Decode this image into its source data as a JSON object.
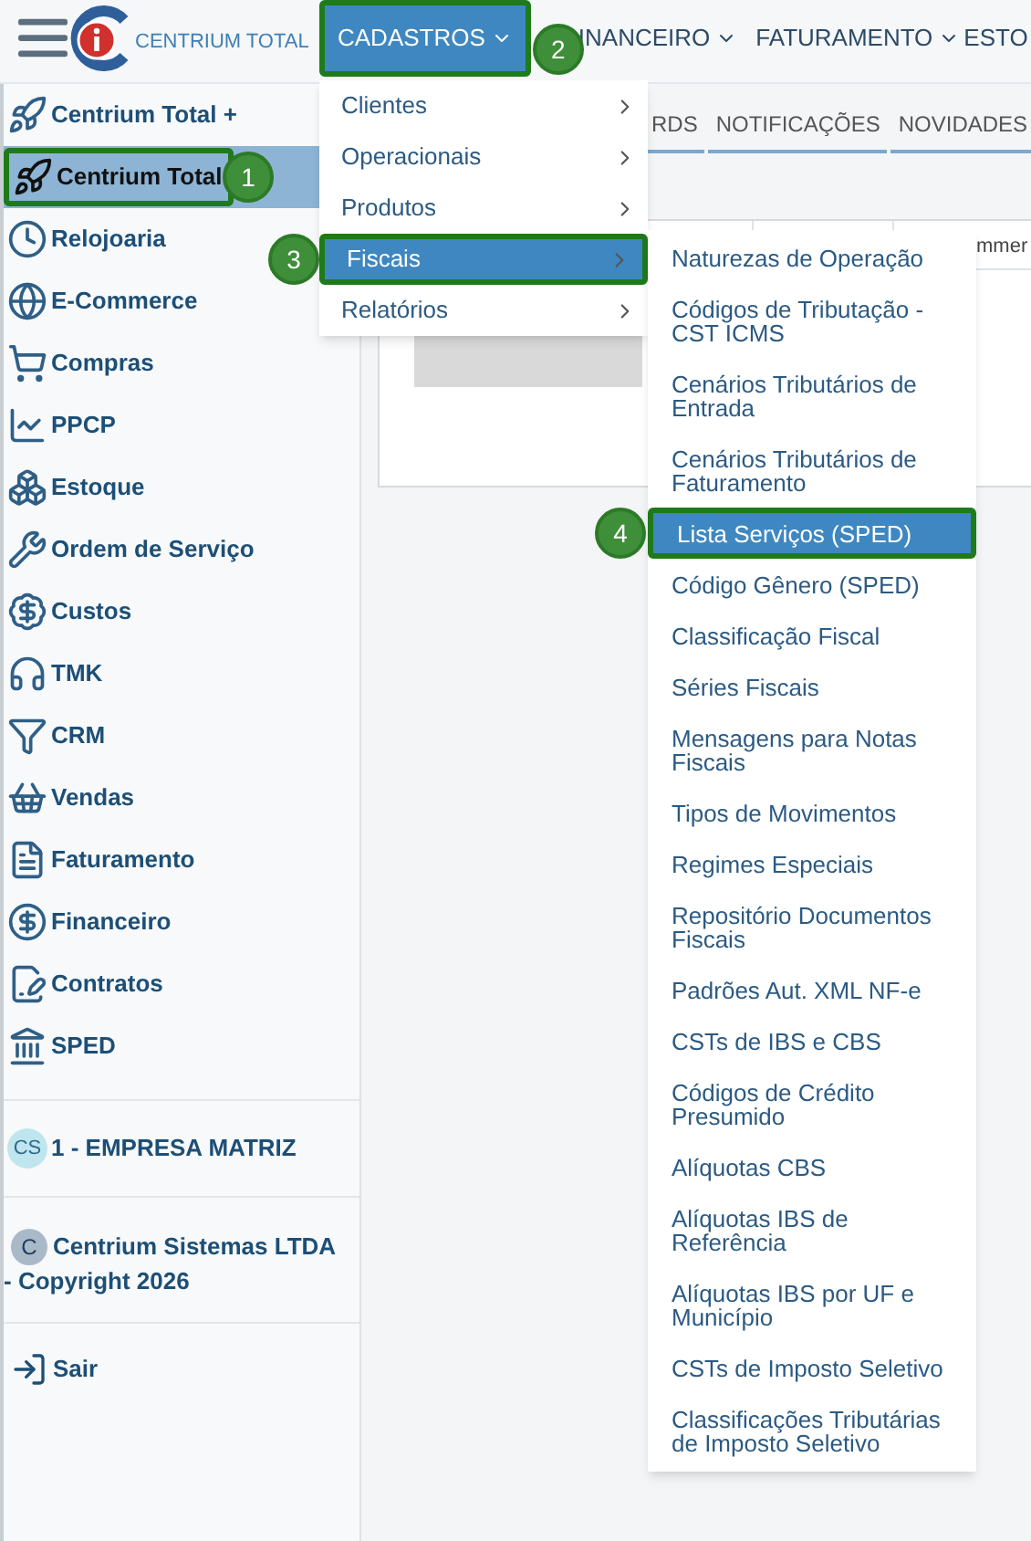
{
  "app": {
    "title": "CENTRIUM TOTAL"
  },
  "nav": [
    {
      "label": "CADASTROS",
      "selected": true,
      "callout": "2"
    },
    {
      "label": "INANCEIRO",
      "selected": false
    },
    {
      "label": "FATURAMENTO",
      "selected": false
    },
    {
      "label": "ESTO",
      "selected": false
    }
  ],
  "sidebar": {
    "items": [
      {
        "label": "Centrium Total +",
        "selected": false
      },
      {
        "label": "Centrium Total",
        "selected": true,
        "callout": "1"
      },
      {
        "label": "Relojoaria",
        "selected": false
      },
      {
        "label": "E-Commerce",
        "selected": false
      },
      {
        "label": "Compras",
        "selected": false
      },
      {
        "label": "PPCP",
        "selected": false
      },
      {
        "label": "Estoque",
        "selected": false
      },
      {
        "label": "Ordem de Serviço",
        "selected": false
      },
      {
        "label": "Custos",
        "selected": false
      },
      {
        "label": "TMK",
        "selected": false
      },
      {
        "label": "CRM",
        "selected": false
      },
      {
        "label": "Vendas",
        "selected": false
      },
      {
        "label": "Faturamento",
        "selected": false
      },
      {
        "label": "Financeiro",
        "selected": false
      },
      {
        "label": "Contratos",
        "selected": false
      },
      {
        "label": "SPED",
        "selected": false
      }
    ],
    "company": {
      "avatar": "CS",
      "label": "1 - EMPRESA MATRIZ"
    },
    "copyright": {
      "avatar": "C",
      "label": "Centrium Sistemas LTDA",
      "line_2": "- Copyright 2026"
    },
    "logout": "Sair"
  },
  "tabs": [
    {
      "label": "RDS"
    },
    {
      "label": "NOTIFICAÇÕES"
    },
    {
      "label": "NOVIDADES"
    }
  ],
  "table": {
    "column_4": "mmer"
  },
  "menu": {
    "items": [
      {
        "label": "Clientes",
        "selected": false
      },
      {
        "label": "Operacionais",
        "selected": false
      },
      {
        "label": "Produtos",
        "selected": false
      },
      {
        "label": "Fiscais",
        "selected": true,
        "callout": "3"
      },
      {
        "label": "Relatórios",
        "selected": false
      }
    ]
  },
  "submenu": {
    "items": [
      {
        "label": "Naturezas de Operação",
        "selected": false
      },
      {
        "label": "Códigos de Tributação - CST ICMS",
        "selected": false
      },
      {
        "label": "Cenários Tributários de Entrada",
        "selected": false
      },
      {
        "label": "Cenários Tributários de Faturamento",
        "selected": false
      },
      {
        "label": "Lista Serviços (SPED)",
        "selected": true,
        "callout": "4"
      },
      {
        "label": "Código Gênero (SPED)",
        "selected": false
      },
      {
        "label": "Classificação Fiscal",
        "selected": false
      },
      {
        "label": "Séries Fiscais",
        "selected": false
      },
      {
        "label": "Mensagens para Notas Fiscais",
        "selected": false
      },
      {
        "label": "Tipos de Movimentos",
        "selected": false
      },
      {
        "label": "Regimes Especiais",
        "selected": false
      },
      {
        "label": "Repositório Documentos Fiscais",
        "selected": false
      },
      {
        "label": "Padrões Aut. XML NF-e",
        "selected": false
      },
      {
        "label": "CSTs de IBS e CBS",
        "selected": false
      },
      {
        "label": "Códigos de Crédito Presumido",
        "selected": false
      },
      {
        "label": "Alíquotas CBS",
        "selected": false
      },
      {
        "label": "Alíquotas IBS de Referência",
        "selected": false
      },
      {
        "label": "Alíquotas IBS por UF e Município",
        "selected": false
      },
      {
        "label": "CSTs de Imposto Seletivo",
        "selected": false
      },
      {
        "label": "Classificações Tributárias de Imposto Seletivo",
        "selected": false
      }
    ]
  }
}
